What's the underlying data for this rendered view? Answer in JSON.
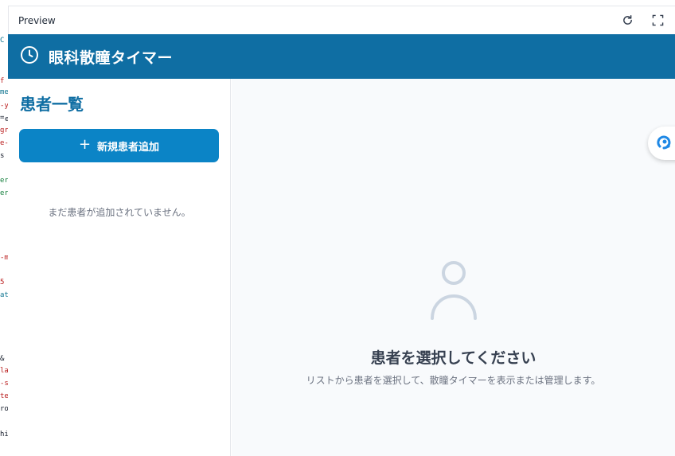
{
  "code_strip": [
    "C",
    "f",
    "me",
    "-y",
    "=",
    "e",
    "gr",
    "e-",
    "s",
    "er",
    "er",
    "-m",
    "5",
    "at",
    "&",
    "la",
    "-s",
    "te",
    "ro",
    "hi"
  ],
  "preview": {
    "title": "Preview",
    "refresh_icon": "refresh-icon",
    "fullscreen_icon": "fullscreen-icon"
  },
  "app": {
    "title": "眼科散瞳タイマー",
    "logo_icon": "clock-icon",
    "header_color": "#0f6ea3"
  },
  "sidebar": {
    "title": "患者一覧",
    "add_button_label": "新規患者追加",
    "add_button_icon": "plus-icon",
    "empty_message": "まだ患者が追加されていません。",
    "accent_color": "#0b84c6"
  },
  "main": {
    "empty_title": "患者を選択してください",
    "empty_subtitle": "リストから患者を選択して、散瞳タイマーを表示または管理します。",
    "empty_icon": "user-icon"
  },
  "float_badge_icon": "assistant-icon"
}
